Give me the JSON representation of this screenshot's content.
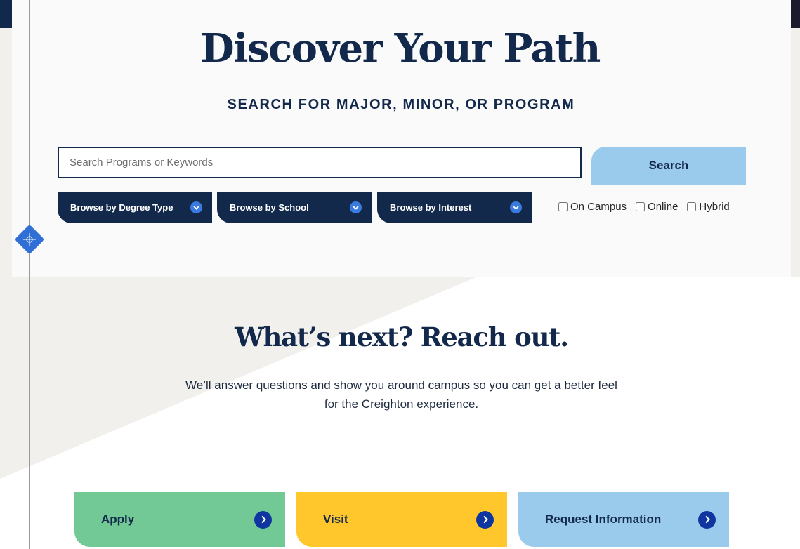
{
  "hero": {
    "title": "Discover Your Path",
    "subtitle": "SEARCH FOR MAJOR, MINOR, OR PROGRAM"
  },
  "search": {
    "placeholder": "Search Programs or Keywords",
    "value": "",
    "button_label": "Search"
  },
  "browse": [
    {
      "label": "Browse by Degree Type"
    },
    {
      "label": "Browse by School"
    },
    {
      "label": "Browse by Interest"
    }
  ],
  "filters": [
    {
      "label": "On Campus",
      "checked": false
    },
    {
      "label": "Online",
      "checked": false
    },
    {
      "label": "Hybrid",
      "checked": false
    }
  ],
  "contact": {
    "heading": "What’s next? Reach out.",
    "text": "We’ll answer questions and show you around campus so you can get a better feel for the Creighton experience."
  },
  "cta": [
    {
      "label": "Apply",
      "color": "#72c995"
    },
    {
      "label": "Visit",
      "color": "#ffc72c"
    },
    {
      "label": "Request Information",
      "color": "#9acbec"
    }
  ],
  "colors": {
    "navy": "#13294b",
    "accent_blue": "#3a7be0",
    "light_blue": "#9acbec",
    "panel_bg": "#fafafa",
    "beige": "#f1f0ec"
  },
  "icons": {
    "dropdown": "chevron-down-icon",
    "cta": "chevron-right-icon",
    "marker": "compass-icon"
  }
}
